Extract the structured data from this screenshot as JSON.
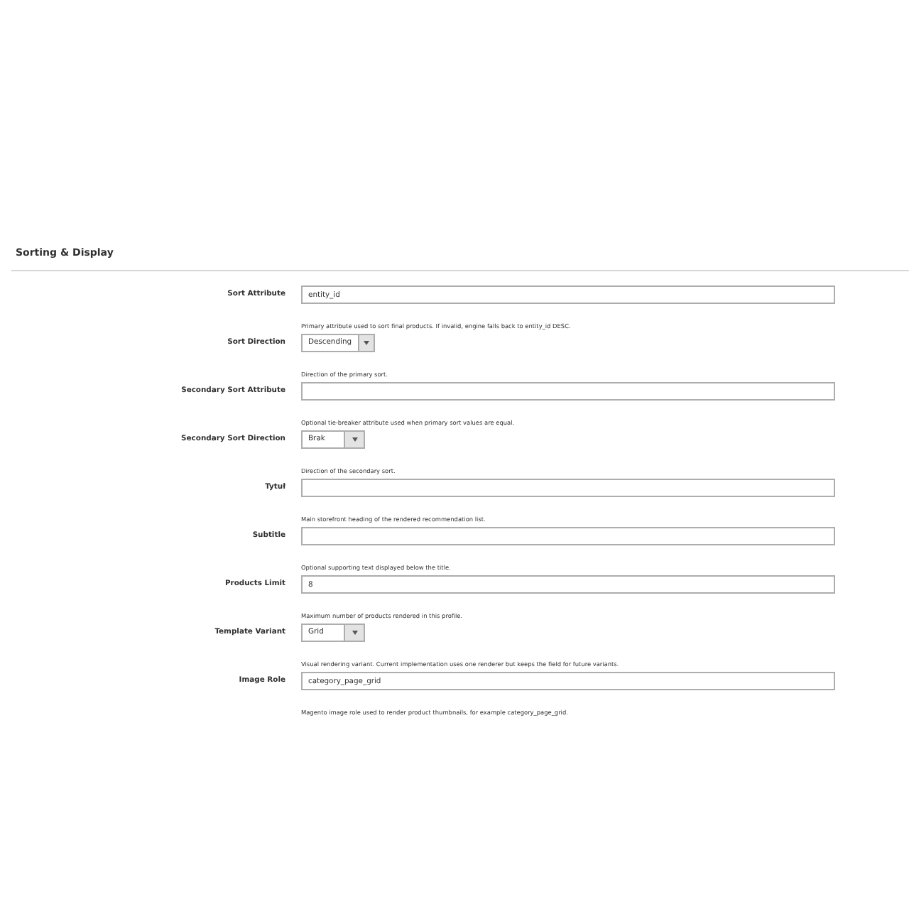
{
  "section": {
    "title": "Sorting & Display"
  },
  "fields": [
    {
      "kind": "text",
      "label": "Sort Attribute",
      "value": "entity_id",
      "note": "Primary attribute used to sort final products. If invalid, engine falls back to entity_id DESC."
    },
    {
      "kind": "select",
      "label": "Sort Direction",
      "value": "Descending",
      "note": "Direction of the primary sort."
    },
    {
      "kind": "text",
      "label": "Secondary Sort Attribute",
      "note": "Optional tie-breaker attribute used when primary sort values are equal."
    },
    {
      "kind": "select",
      "label": "Secondary Sort Direction",
      "value": "Brak",
      "note": "Direction of the secondary sort."
    },
    {
      "kind": "text",
      "label": "Tytuł",
      "note": "Main storefront heading of the rendered recommendation list."
    },
    {
      "kind": "text",
      "label": "Subtitle",
      "note": "Optional supporting text displayed below the title."
    },
    {
      "kind": "text",
      "label": "Products Limit",
      "value": "8",
      "note": "Maximum number of products rendered in this profile."
    },
    {
      "kind": "select",
      "label": "Template Variant",
      "value": "Grid",
      "note": "Visual rendering variant. Current implementation uses one renderer but keeps the field for future variants."
    },
    {
      "kind": "text",
      "label": "Image Role",
      "value": "category_page_grid",
      "note": "Magento image role used to render product thumbnails, for example category_page_grid."
    }
  ]
}
